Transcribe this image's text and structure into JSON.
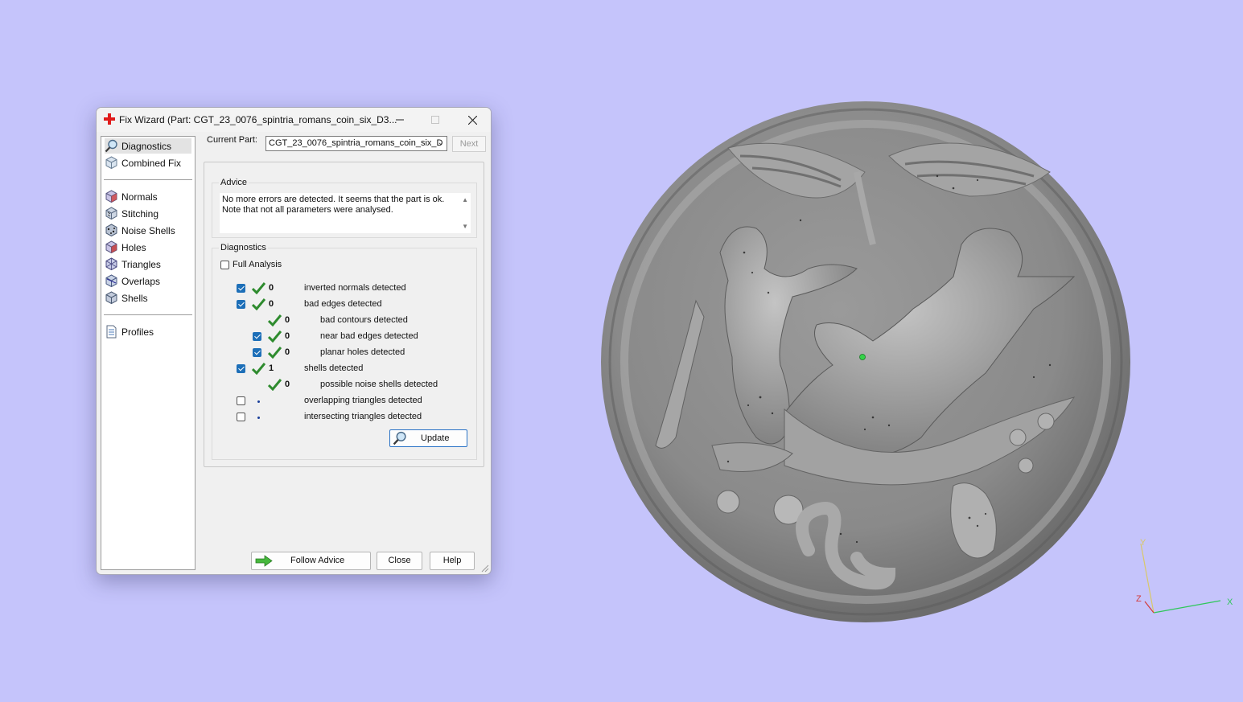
{
  "window": {
    "title": "Fix Wizard (Part: CGT_23_0076_spintria_romans_coin_six_D3...",
    "icon": "red-cross-icon"
  },
  "sidebar": {
    "items": [
      {
        "label": "Diagnostics",
        "icon": "magnifier-icon",
        "selected": true
      },
      {
        "label": "Combined Fix",
        "icon": "cube-icon"
      },
      {
        "label": "Normals",
        "icon": "normals-cube-icon"
      },
      {
        "label": "Stitching",
        "icon": "stitching-cube-icon"
      },
      {
        "label": "Noise Shells",
        "icon": "noise-shells-icon"
      },
      {
        "label": "Holes",
        "icon": "holes-cube-icon"
      },
      {
        "label": "Triangles",
        "icon": "triangles-cube-icon"
      },
      {
        "label": "Overlaps",
        "icon": "overlaps-cube-icon"
      },
      {
        "label": "Shells",
        "icon": "shells-cube-icon"
      },
      {
        "label": "Profiles",
        "icon": "profiles-document-icon"
      }
    ]
  },
  "current_part": {
    "label": "Current Part:",
    "value": "CGT_23_0076_spintria_romans_coin_six_D",
    "next_label": "Next"
  },
  "advice": {
    "title": "Advice",
    "text": "No more errors are detected. It seems that the part is ok.\nNote that not all parameters were analysed."
  },
  "diagnostics": {
    "title": "Diagnostics",
    "full_analysis_label": "Full Analysis",
    "full_analysis_checked": false,
    "rows": [
      {
        "checkbox": "checked",
        "status": "ok",
        "count": "0",
        "label": "inverted normals detected",
        "indent": 0
      },
      {
        "checkbox": "checked",
        "status": "ok",
        "count": "0",
        "label": "bad edges detected",
        "indent": 0
      },
      {
        "checkbox": "none",
        "status": "ok",
        "count": "0",
        "label": "bad contours detected",
        "indent": 1
      },
      {
        "checkbox": "checked",
        "status": "ok",
        "count": "0",
        "label": "near bad edges detected",
        "indent": 1
      },
      {
        "checkbox": "checked",
        "status": "ok",
        "count": "0",
        "label": "planar holes detected",
        "indent": 1
      },
      {
        "checkbox": "checked",
        "status": "ok",
        "count": "1",
        "label": "shells detected",
        "indent": 0
      },
      {
        "checkbox": "none",
        "status": "ok",
        "count": "0",
        "label": "possible noise shells detected",
        "indent": 1
      },
      {
        "checkbox": "unchecked",
        "status": "dot",
        "count": "",
        "label": "overlapping triangles detected",
        "indent": 0
      },
      {
        "checkbox": "unchecked",
        "status": "dot",
        "count": "",
        "label": "intersecting triangles detected",
        "indent": 0
      }
    ],
    "update_label": "Update"
  },
  "buttons": {
    "follow_advice": "Follow Advice",
    "close": "Close",
    "help": "Help"
  },
  "viewport": {
    "background": "#c5c4fb",
    "axis_labels": {
      "x": "X",
      "y": "Y",
      "z": "Z"
    },
    "axis_colors": {
      "x": "#2fc75a",
      "y": "#d9c86a",
      "z": "#d23a3a"
    }
  }
}
